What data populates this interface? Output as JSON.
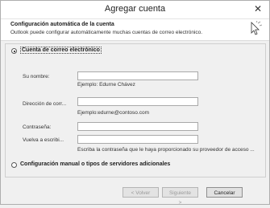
{
  "window": {
    "title": "Agregar cuenta",
    "close_glyph": "✕"
  },
  "header": {
    "title": "Configuración automática de la cuenta",
    "subtitle": "Outlook puede configurar automáticamente muchas cuentas de correo electrónico.",
    "icon": "cursor-arrow-icon"
  },
  "options": {
    "email_account": {
      "label": "Cuenta de correo electrónico",
      "selected": true
    },
    "manual": {
      "label": "Configuración manual o tipos de servidores adicionales",
      "selected": false
    }
  },
  "form": {
    "name": {
      "label": "Su nombre:",
      "value": "",
      "hint": "Ejemplo: Edurne Chávez"
    },
    "email": {
      "label": "Dirección de corr...",
      "value": "",
      "hint": "Ejemplo:edurne@contoso.com"
    },
    "password": {
      "label": "Contraseña:",
      "value": ""
    },
    "retype": {
      "label": "Vuelva a escribi...",
      "value": "",
      "hint": "Escriba la contraseña que le haya proporcionado su proveedor de acceso ..."
    }
  },
  "buttons": {
    "back": "< Volver",
    "next": "Siguiente >",
    "cancel": "Cancelar"
  }
}
